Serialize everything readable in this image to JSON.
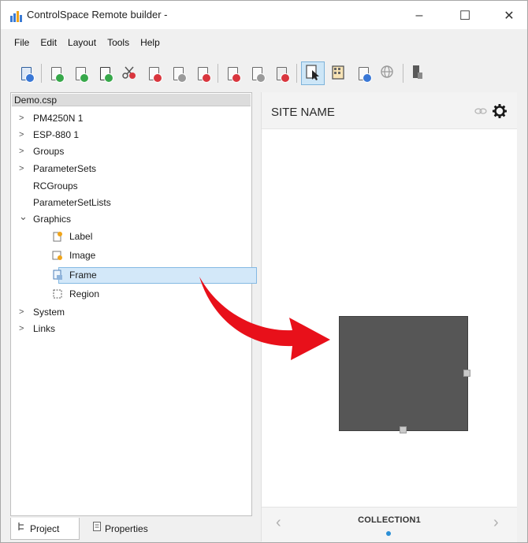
{
  "window": {
    "title": "ControlSpace Remote builder -",
    "minimize_glyph": "–",
    "maximize_glyph": "☐",
    "close_glyph": "✕"
  },
  "menu": [
    "File",
    "Edit",
    "Layout",
    "Tools",
    "Help"
  ],
  "toolbar": {
    "buttons": [
      {
        "icon": "save-doc-icon"
      },
      {
        "icon": "new-doc-green-icon"
      },
      {
        "icon": "add-doc-green-icon"
      },
      {
        "icon": "save-green-icon"
      },
      {
        "icon": "cut-icon"
      },
      {
        "icon": "delete-doc-red-icon"
      },
      {
        "icon": "copy-doc-icon"
      },
      {
        "icon": "remove-doc-red-icon"
      },
      {
        "icon": "delete-red-icon"
      },
      {
        "icon": "doc-grey-icon"
      },
      {
        "icon": "doc-red-icon"
      },
      {
        "icon": "select-pointer-icon",
        "active": true
      },
      {
        "icon": "panel-grid-icon"
      },
      {
        "icon": "doc-blue-icon"
      },
      {
        "icon": "globe-icon"
      },
      {
        "icon": "device-icon"
      }
    ]
  },
  "tree": {
    "root": "Demo.csp",
    "items": [
      {
        "label": "PM4250N 1",
        "expander": ">"
      },
      {
        "label": "ESP-880 1",
        "expander": ">"
      },
      {
        "label": "Groups",
        "expander": ">"
      },
      {
        "label": "ParameterSets",
        "expander": ">"
      },
      {
        "label": "RCGroups",
        "expander": ""
      },
      {
        "label": "ParameterSetLists",
        "expander": ""
      },
      {
        "label": "Graphics",
        "expander": "⌄"
      },
      {
        "label": "Label",
        "icon": "label-icon"
      },
      {
        "label": "Image",
        "icon": "image-icon"
      },
      {
        "label": "Frame",
        "icon": "frame-icon",
        "selected": true
      },
      {
        "label": "Region",
        "icon": "region-icon"
      },
      {
        "label": "System",
        "expander": ">"
      },
      {
        "label": "Links",
        "expander": ">"
      }
    ]
  },
  "tabs": [
    {
      "label": "Project",
      "active": true
    },
    {
      "label": "Properties",
      "active": false
    }
  ],
  "preview": {
    "site_name": "SITE NAME",
    "collection": "COLLECTION1",
    "prev_glyph": "‹",
    "next_glyph": "›"
  },
  "colors": {
    "selection": "#d3e8f9",
    "frame_fill": "#565656",
    "arrow": "#e8101a",
    "page_dot": "#2b8fd6"
  }
}
